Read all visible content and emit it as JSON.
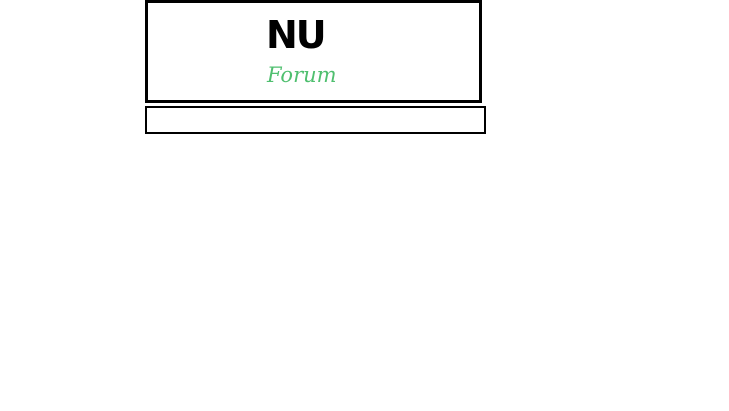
{
  "header": {
    "title": "NU",
    "subtitle": "Forum"
  },
  "colors": {
    "border": "#000000",
    "title": "#000000",
    "subtitle": "#4fbf6f",
    "background": "#ffffff"
  }
}
